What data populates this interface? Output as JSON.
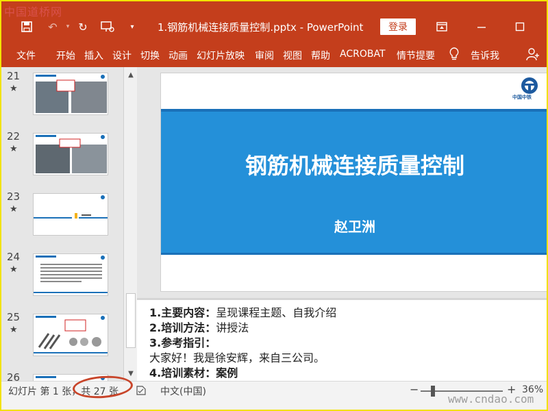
{
  "watermark": {
    "top": "中国道桥网",
    "bottom": "www.cndao.com"
  },
  "titlebar": {
    "doc_title": "1.钢筋机械连接质量控制.pptx - PowerPoint",
    "login_label": "登录"
  },
  "ribbon": {
    "tabs": [
      "文件",
      "开始",
      "插入",
      "设计",
      "切换",
      "动画",
      "幻灯片放映",
      "审阅",
      "视图",
      "帮助",
      "ACROBAT",
      "情节提要",
      "告诉我"
    ]
  },
  "thumbnails": [
    {
      "num": "21",
      "star": "★"
    },
    {
      "num": "22",
      "star": "★"
    },
    {
      "num": "23",
      "star": "★"
    },
    {
      "num": "24",
      "star": "★"
    },
    {
      "num": "25",
      "star": "★"
    },
    {
      "num": "26",
      "star": ""
    }
  ],
  "slide": {
    "title": "钢筋机械连接质量控制",
    "subtitle": "赵卫洲",
    "logo_text": "中国中铁"
  },
  "notes": {
    "l1_label": "1.主要内容：",
    "l1_text": "呈现课程主题、自我介绍",
    "l2_label": "2.培训方法：",
    "l2_text": "讲授法",
    "l3_label": "3.参考指引：",
    "l4_text": "大家好！我是徐安辉，来自三公司。",
    "l5_label": "4.培训素材：案例"
  },
  "status": {
    "slide_info": "幻灯片 第 1 张，共 27 张",
    "language": "中文(中国)",
    "zoom": "36%",
    "zoom_minus": "−",
    "zoom_plus": "+"
  },
  "colors": {
    "accent": "#c43e1c",
    "slide_blue": "#2490d9"
  }
}
